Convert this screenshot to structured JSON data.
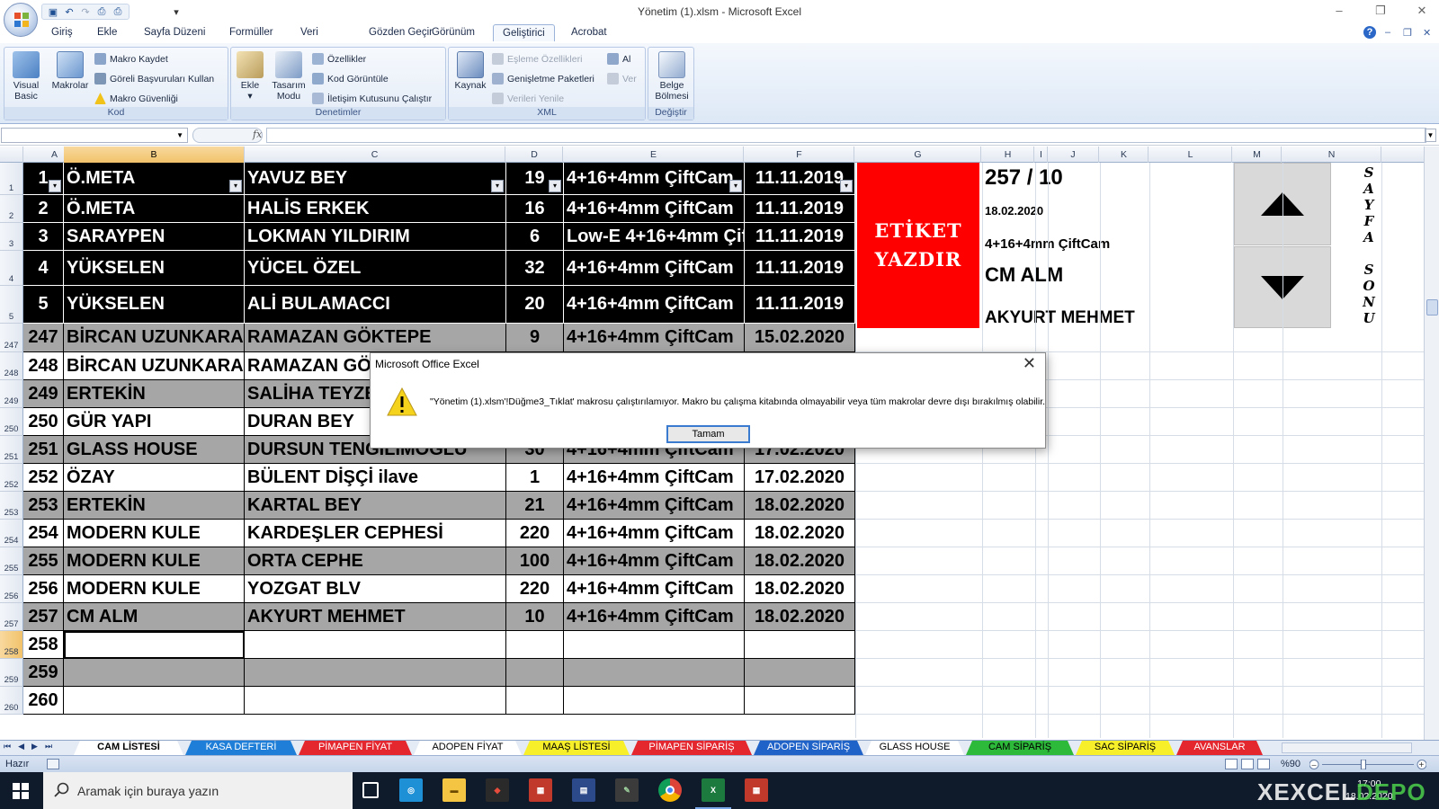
{
  "window": {
    "title": "Yönetim (1).xlsm - Microsoft Excel",
    "minimize": "–",
    "restore": "❐",
    "close": "✕"
  },
  "menu": {
    "tabs": [
      "Giriş",
      "Ekle",
      "Sayfa Düzeni",
      "Formüller",
      "Veri",
      "Gözden Geçir",
      "Görünüm",
      "Geliştirici",
      "Acrobat"
    ],
    "active_tab": "Geliştirici",
    "help_icon": "?"
  },
  "ribbon": {
    "kod": {
      "label": "Kod",
      "visual_basic": "Visual Basic",
      "makrolar": "Makrolar",
      "makro_kaydet": "Makro Kaydet",
      "goreli": "Göreli Başvuruları Kullan",
      "guvenlik": "Makro Güvenliği"
    },
    "denetimler": {
      "label": "Denetimler",
      "ekle": "Ekle",
      "tasarim": "Tasarım Modu",
      "ozellikler": "Özellikler",
      "kod_goruntule": "Kod Görüntüle",
      "iletisim": "İletişim Kutusunu Çalıştır"
    },
    "xml": {
      "label": "XML",
      "kaynak": "Kaynak",
      "esleme": "Eşleme Özellikleri",
      "genisletme": "Genişletme Paketleri",
      "verileri_yenile": "Verileri Yenile",
      "al": "Al",
      "ver": "Ver"
    },
    "degistir": {
      "label": "Değiştir",
      "belge_bolmesi": "Belge Bölmesi"
    }
  },
  "formula_bar": {
    "name_box": "",
    "fx": "fx",
    "content": ""
  },
  "grid": {
    "columns": [
      "A",
      "B",
      "C",
      "D",
      "E",
      "F",
      "G",
      "H",
      "I",
      "J",
      "K",
      "L",
      "M",
      "N"
    ],
    "selected_column": "B",
    "rows": [
      {
        "rownum": "1",
        "no": "1",
        "firma": "Ö.META",
        "musteri": "YAVUZ BEY",
        "adet": "19",
        "cam": "4+16+4mm ÇiftCam",
        "tarih": "11.11.2019",
        "style": "black"
      },
      {
        "rownum": "2",
        "no": "2",
        "firma": "Ö.META",
        "musteri": "HALİS ERKEK",
        "adet": "16",
        "cam": "4+16+4mm ÇiftCam",
        "tarih": "11.11.2019",
        "style": "black"
      },
      {
        "rownum": "3",
        "no": "3",
        "firma": "SARAYPEN",
        "musteri": "LOKMAN YILDIRIM",
        "adet": "6",
        "cam": "Low-E 4+16+4mm Çif",
        "tarih": "11.11.2019",
        "style": "black"
      },
      {
        "rownum": "4",
        "no": "4",
        "firma": "YÜKSELEN",
        "musteri": "YÜCEL ÖZEL",
        "adet": "32",
        "cam": "4+16+4mm ÇiftCam",
        "tarih": "11.11.2019",
        "style": "black"
      },
      {
        "rownum": "5",
        "no": "5",
        "firma": "YÜKSELEN",
        "musteri": "ALİ BULAMACCI",
        "adet": "20",
        "cam": "4+16+4mm ÇiftCam",
        "tarih": "11.11.2019",
        "style": "black"
      },
      {
        "rownum": "247",
        "no": "247",
        "firma": "BİRCAN UZUNKARA",
        "musteri": "RAMAZAN GÖKTEPE",
        "adet": "9",
        "cam": "4+16+4mm ÇiftCam",
        "tarih": "15.02.2020",
        "style": "grey"
      },
      {
        "rownum": "248",
        "no": "248",
        "firma": "BİRCAN UZUNKARA",
        "musteri": "RAMAZAN GÖKTEPE",
        "adet": "",
        "cam": "",
        "tarih": "",
        "style": "white"
      },
      {
        "rownum": "249",
        "no": "249",
        "firma": "ERTEKİN",
        "musteri": "SALİHA TEYZE",
        "adet": "",
        "cam": "",
        "tarih": "",
        "style": "grey"
      },
      {
        "rownum": "250",
        "no": "250",
        "firma": "GÜR YAPI",
        "musteri": "DURAN BEY",
        "adet": "",
        "cam": "",
        "tarih": "",
        "style": "white"
      },
      {
        "rownum": "251",
        "no": "251",
        "firma": "GLASS HOUSE",
        "musteri": "DURSUN TENGİLİMOĞLU",
        "adet": "30",
        "cam": "4+16+4mm ÇiftCam",
        "tarih": "17.02.2020",
        "style": "grey"
      },
      {
        "rownum": "252",
        "no": "252",
        "firma": "ÖZAY",
        "musteri": "BÜLENT DİŞÇİ ilave",
        "adet": "1",
        "cam": "4+16+4mm ÇiftCam",
        "tarih": "17.02.2020",
        "style": "white"
      },
      {
        "rownum": "253",
        "no": "253",
        "firma": "ERTEKİN",
        "musteri": "KARTAL BEY",
        "adet": "21",
        "cam": "4+16+4mm ÇiftCam",
        "tarih": "18.02.2020",
        "style": "grey"
      },
      {
        "rownum": "254",
        "no": "254",
        "firma": "MODERN KULE",
        "musteri": "KARDEŞLER CEPHESİ",
        "adet": "220",
        "cam": "4+16+4mm ÇiftCam",
        "tarih": "18.02.2020",
        "style": "white"
      },
      {
        "rownum": "255",
        "no": "255",
        "firma": "MODERN KULE",
        "musteri": "ORTA CEPHE",
        "adet": "100",
        "cam": "4+16+4mm ÇiftCam",
        "tarih": "18.02.2020",
        "style": "grey"
      },
      {
        "rownum": "256",
        "no": "256",
        "firma": "MODERN KULE",
        "musteri": "YOZGAT BLV",
        "adet": "220",
        "cam": "4+16+4mm ÇiftCam",
        "tarih": "18.02.2020",
        "style": "white"
      },
      {
        "rownum": "257",
        "no": "257",
        "firma": "CM ALM",
        "musteri": "AKYURT MEHMET",
        "adet": "10",
        "cam": "4+16+4mm ÇiftCam",
        "tarih": "18.02.2020",
        "style": "grey"
      },
      {
        "rownum": "258",
        "no": "258",
        "firma": "",
        "musteri": "",
        "adet": "",
        "cam": "",
        "tarih": "",
        "style": "white"
      },
      {
        "rownum": "259",
        "no": "259",
        "firma": "",
        "musteri": "",
        "adet": "",
        "cam": "",
        "tarih": "",
        "style": "grey"
      },
      {
        "rownum": "260",
        "no": "260",
        "firma": "",
        "musteri": "",
        "adet": "",
        "cam": "",
        "tarih": "",
        "style": "white"
      }
    ],
    "selected_row": "258"
  },
  "print_button": {
    "line1": "ETİKET",
    "line2": "YAZDIR",
    "color": "#fe0000"
  },
  "side_panel": {
    "counter": "257  /  10",
    "date": "18.02.2020",
    "glass": "4+16+4mm ÇiftCam",
    "company": "CM ALM",
    "customer": "AKYURT MEHMET"
  },
  "vertical_label": [
    "S",
    "A",
    "Y",
    "F",
    "A",
    "",
    "S",
    "O",
    "N",
    "U"
  ],
  "dialog": {
    "title": "Microsoft Office Excel",
    "message": "\"Yönetim (1).xlsm'!Düğme3_Tıklat' makrosu çalıştırılamıyor. Makro bu çalışma kitabında olmayabilir veya tüm makrolar devre dışı bırakılmış olabilir.",
    "ok": "Tamam"
  },
  "sheets": [
    {
      "name": "CAM LİSTESİ",
      "color": "#ffffff",
      "text": "#000000",
      "active": true
    },
    {
      "name": "KASA DEFTERİ",
      "color": "#1f7fd8",
      "text": "#ffffff"
    },
    {
      "name": "PİMAPEN FİYAT",
      "color": "#e4262e",
      "text": "#ffffff"
    },
    {
      "name": "ADOPEN FİYAT",
      "color": "#ffffff",
      "text": "#000000"
    },
    {
      "name": "MAAŞ LİSTESİ",
      "color": "#f7ef2a",
      "text": "#000000"
    },
    {
      "name": "PİMAPEN SİPARİŞ",
      "color": "#e4262e",
      "text": "#ffffff"
    },
    {
      "name": "ADOPEN SİPARİŞ",
      "color": "#1f62c8",
      "text": "#ffffff"
    },
    {
      "name": "GLASS HOUSE",
      "color": "#ffffff",
      "text": "#000000"
    },
    {
      "name": "CAM SİPARİŞ",
      "color": "#2dba3b",
      "text": "#000000"
    },
    {
      "name": "SAC SİPARİŞ",
      "color": "#f7ef2a",
      "text": "#000000"
    },
    {
      "name": "AVANSLAR",
      "color": "#e4262e",
      "text": "#ffffff"
    }
  ],
  "status": {
    "ready": "Hazır",
    "zoom": "%90",
    "zoom_fraction": 0.45
  },
  "taskbar": {
    "search_placeholder": "Aramak için buraya yazın",
    "time": "17:00",
    "date": "18.02.2020"
  },
  "watermark": {
    "text1": "XEXCEL",
    "text2": "DEPO"
  }
}
